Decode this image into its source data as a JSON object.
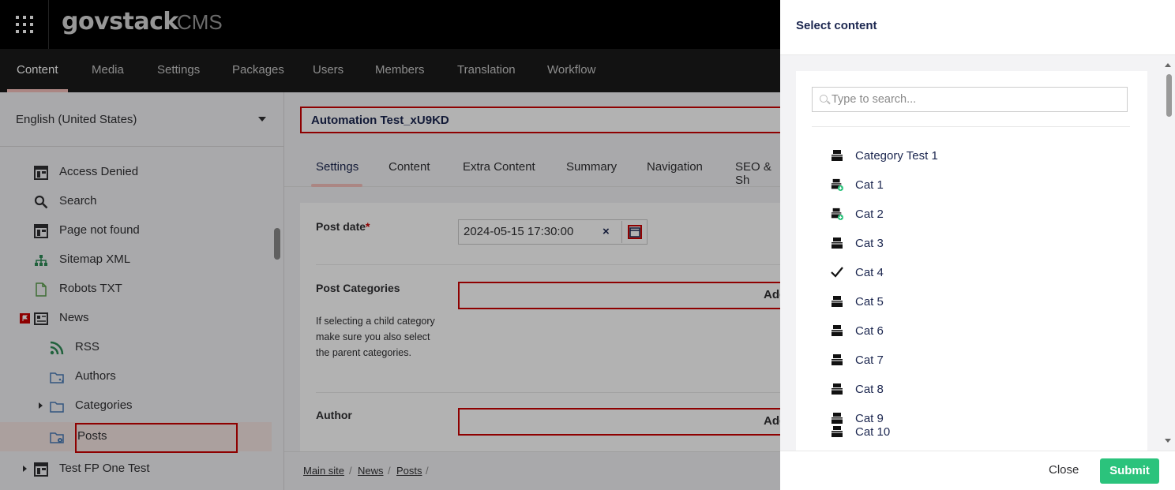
{
  "header": {
    "logo": "govstack",
    "product": "CMS"
  },
  "nav": [
    {
      "label": "Content",
      "active": true
    },
    {
      "label": "Media"
    },
    {
      "label": "Settings"
    },
    {
      "label": "Packages"
    },
    {
      "label": "Users"
    },
    {
      "label": "Members"
    },
    {
      "label": "Translation"
    },
    {
      "label": "Workflow"
    }
  ],
  "tree": {
    "language": "English (United States)",
    "items": [
      {
        "label": "Access Denied",
        "icon": "layout-icon"
      },
      {
        "label": "Search",
        "icon": "search-icon"
      },
      {
        "label": "Page not found",
        "icon": "layout-icon"
      },
      {
        "label": "Sitemap XML",
        "icon": "sitemap-icon"
      },
      {
        "label": "Robots TXT",
        "icon": "document-icon"
      },
      {
        "label": "News",
        "icon": "newspaper-icon"
      },
      {
        "label": "RSS",
        "icon": "rss-icon"
      },
      {
        "label": "Authors",
        "icon": "folder-users-icon"
      },
      {
        "label": "Categories",
        "icon": "folder-icon"
      },
      {
        "label": "Posts",
        "icon": "folder-settings-icon",
        "selected": true
      },
      {
        "label": "Test FP One Test",
        "icon": "layout-icon"
      }
    ]
  },
  "editor": {
    "name": "Automation Test_xU9KD",
    "tabs": [
      "Settings",
      "Content",
      "Extra Content",
      "Summary",
      "Navigation",
      "SEO & Sh"
    ],
    "post_date_label": "Post date",
    "required_mark": "*",
    "post_date_value": "2024-05-15 17:30:00",
    "clear_symbol": "×",
    "post_categories_label": "Post Categories",
    "post_categories_desc": "If selecting a child category make sure you also select the parent categories.",
    "add_label": "Add",
    "author_label": "Author",
    "breadcrumb": [
      "Main site",
      "News",
      "Posts"
    ],
    "breadcrumb_sep": "/"
  },
  "dialog": {
    "title": "Select content",
    "search_placeholder": "Type to search...",
    "items": [
      {
        "label": "Category Test 1",
        "icon": "drawer-icon"
      },
      {
        "label": "Cat 1",
        "icon": "drawer-add-icon"
      },
      {
        "label": "Cat 2",
        "icon": "drawer-add-icon"
      },
      {
        "label": "Cat 3",
        "icon": "drawer-icon"
      },
      {
        "label": "Cat 4",
        "icon": "checkmark-icon"
      },
      {
        "label": "Cat 5",
        "icon": "drawer-icon"
      },
      {
        "label": "Cat 6",
        "icon": "drawer-icon"
      },
      {
        "label": "Cat 7",
        "icon": "drawer-icon"
      },
      {
        "label": "Cat 8",
        "icon": "drawer-icon"
      },
      {
        "label": "Cat 9",
        "icon": "drawer-icon"
      },
      {
        "label": "Cat 10",
        "icon": "drawer-icon"
      }
    ],
    "close_label": "Close",
    "submit_label": "Submit"
  },
  "colors": {
    "accent_red": "#cc0000",
    "submit_green": "#2bc37c",
    "tab_underline": "#f5c1bc",
    "text": "#1b264f"
  }
}
